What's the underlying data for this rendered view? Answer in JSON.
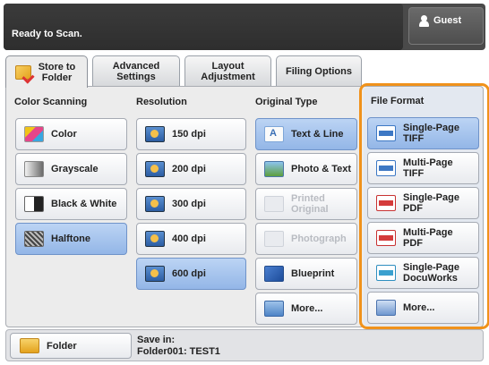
{
  "header": {
    "status": "Ready to Scan.",
    "user_label": "Guest"
  },
  "tabs": [
    {
      "label": "Store to Folder",
      "active": true
    },
    {
      "label": "Advanced Settings",
      "active": false
    },
    {
      "label": "Layout Adjustment",
      "active": false
    },
    {
      "label": "Filing Options",
      "active": false
    }
  ],
  "color_scanning": {
    "title": "Color Scanning",
    "options": [
      {
        "label": "Color",
        "icon": "color-icon"
      },
      {
        "label": "Grayscale",
        "icon": "grayscale-icon"
      },
      {
        "label": "Black & White",
        "icon": "black-white-icon"
      },
      {
        "label": "Halftone",
        "icon": "halftone-icon",
        "selected": true
      }
    ]
  },
  "resolution": {
    "title": "Resolution",
    "options": [
      {
        "label": "150 dpi"
      },
      {
        "label": "200 dpi"
      },
      {
        "label": "300 dpi"
      },
      {
        "label": "400 dpi"
      },
      {
        "label": "600 dpi",
        "selected": true
      }
    ]
  },
  "original_type": {
    "title": "Original Type",
    "options": [
      {
        "label": "Text & Line",
        "selected": true
      },
      {
        "label": "Photo & Text"
      },
      {
        "label": "Printed Original",
        "disabled": true
      },
      {
        "label": "Photograph",
        "disabled": true
      },
      {
        "label": "Blueprint"
      },
      {
        "label": "More..."
      }
    ]
  },
  "file_format": {
    "title": "File Format",
    "highlight_color": "#f0921b",
    "options": [
      {
        "label_line1": "Single-Page",
        "label_line2": "TIFF",
        "selected": true
      },
      {
        "label_line1": "Multi-Page",
        "label_line2": "TIFF"
      },
      {
        "label_line1": "Single-Page",
        "label_line2": "PDF"
      },
      {
        "label_line1": "Multi-Page",
        "label_line2": "PDF"
      },
      {
        "label_line1": "Single-Page",
        "label_line2": "DocuWorks"
      },
      {
        "label_line1": "More...",
        "label_line2": ""
      }
    ]
  },
  "footer": {
    "folder_button": "Folder",
    "save_in_label": "Save in:",
    "save_in_value": "Folder001: TEST1"
  },
  "colors": {
    "selected_blue": "#93b6e7",
    "highlight_orange": "#f0921b",
    "status_bar": "#2e2e2e"
  }
}
